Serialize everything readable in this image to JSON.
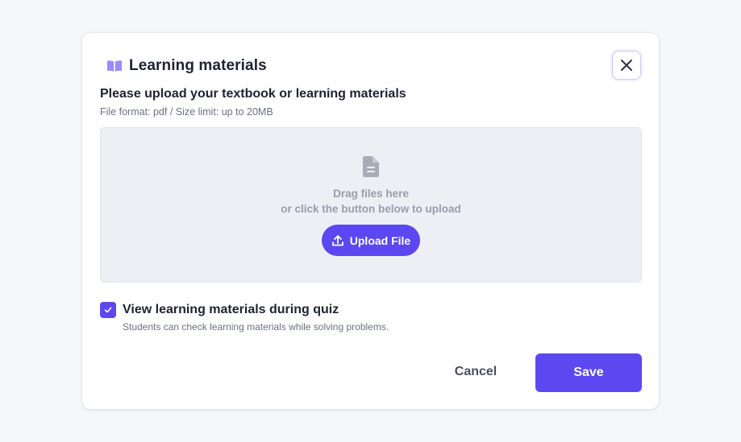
{
  "modal": {
    "title": "Learning materials",
    "title_icon": "book-open-icon",
    "close_icon": "close-icon"
  },
  "upload": {
    "heading": "Please upload your textbook or learning materials",
    "format_note": "File format: pdf / Size limit: up to 20MB",
    "dropzone_icon": "file-text-icon",
    "drag_text": "Drag files here",
    "click_text": "or click the button below to upload",
    "button_label": "Upload File",
    "button_icon": "upload-icon"
  },
  "option": {
    "checked": true,
    "label": "View learning materials during quiz",
    "help": "Students can check learning materials while solving problems."
  },
  "actions": {
    "cancel_label": "Cancel",
    "save_label": "Save"
  },
  "colors": {
    "accent": "#5b48f0",
    "book_icon": "#9b8cf5",
    "muted_text": "#9a9cab",
    "dropzone_bg": "#eeeff4"
  }
}
